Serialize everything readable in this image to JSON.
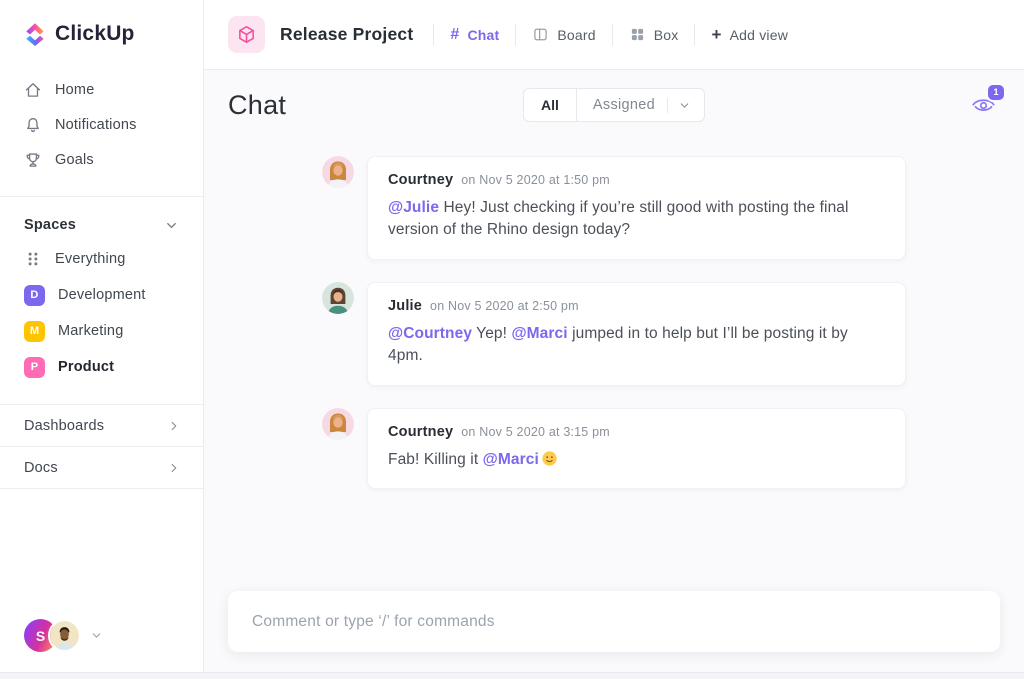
{
  "brand": "ClickUp",
  "sidebar": {
    "nav": [
      {
        "label": "Home",
        "icon": "home-icon"
      },
      {
        "label": "Notifications",
        "icon": "bell-icon"
      },
      {
        "label": "Goals",
        "icon": "trophy-icon"
      }
    ],
    "spaces": {
      "header": "Spaces",
      "items": [
        {
          "label": "Everything"
        },
        {
          "label": "Development",
          "badge": "D",
          "color": "#7b68ee"
        },
        {
          "label": "Marketing",
          "badge": "M",
          "color": "#ffc400"
        },
        {
          "label": "Product",
          "badge": "P",
          "color": "#ff6bb5"
        }
      ]
    },
    "links": [
      {
        "label": "Dashboards"
      },
      {
        "label": "Docs"
      }
    ],
    "user_initial": "S"
  },
  "topbar": {
    "project": "Release Project",
    "views": [
      {
        "label": "Chat"
      },
      {
        "label": "Board"
      },
      {
        "label": "Box"
      }
    ],
    "add_view": "Add view"
  },
  "chat": {
    "title": "Chat",
    "filter_all": "All",
    "filter_assigned": "Assigned",
    "watchers_count": "1",
    "messages": [
      {
        "author": "Courtney",
        "timestamp": "on Nov 5 2020 at 1:50 pm",
        "avatar": "courtney",
        "body": [
          {
            "t": "mention",
            "text": "@Julie"
          },
          {
            "t": "text",
            "text": " Hey! Just checking if you’re still good with posting the final version of the Rhino design today?"
          }
        ]
      },
      {
        "author": "Julie",
        "timestamp": "on Nov 5 2020 at 2:50 pm",
        "avatar": "julie",
        "body": [
          {
            "t": "mention",
            "text": "@Courtney"
          },
          {
            "t": "text",
            "text": " Yep! "
          },
          {
            "t": "mention",
            "text": "@Marci"
          },
          {
            "t": "text",
            "text": " jumped in to help but I’ll be posting it by 4pm."
          }
        ]
      },
      {
        "author": "Courtney",
        "timestamp": "on Nov 5 2020 at 3:15 pm",
        "avatar": "courtney",
        "body": [
          {
            "t": "text",
            "text": "Fab! Killing it "
          },
          {
            "t": "mention",
            "text": "@Marci"
          },
          {
            "t": "emoji",
            "name": "slightly-smiling-face"
          }
        ]
      }
    ],
    "composer_placeholder": "Comment or type ‘/’ for commands"
  },
  "colors": {
    "accent_purple": "#7b68ee",
    "brand_pink": "#f5509f",
    "border": "#e9ebf0"
  }
}
